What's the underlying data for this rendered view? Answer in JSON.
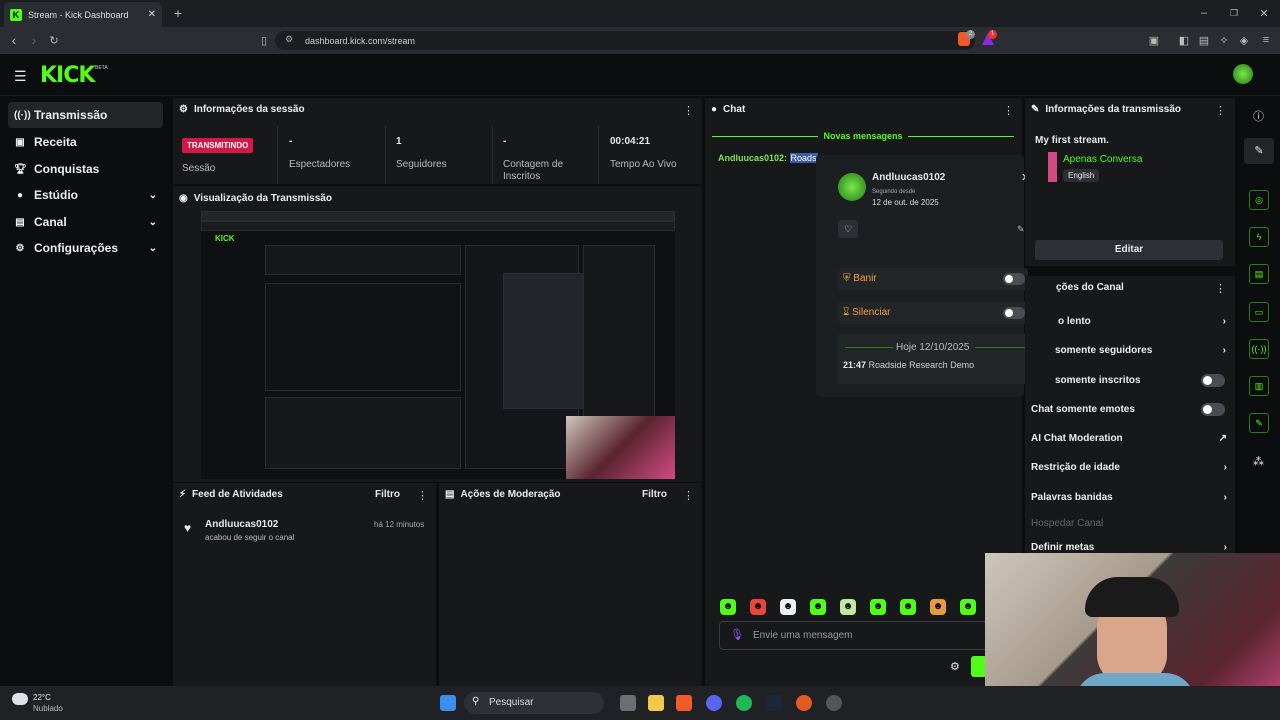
{
  "browser": {
    "tab_title": "Stream - Kick Dashboard",
    "url": "dashboard.kick.com/stream",
    "ext_badge_1": "2",
    "ext_badge_2": "1"
  },
  "app": {
    "logo": "KICK",
    "beta": "BETA"
  },
  "sidebar": {
    "items": [
      {
        "label": "Transmissão",
        "icon": "broadcast-icon"
      },
      {
        "label": "Receita",
        "icon": "revenue-icon"
      },
      {
        "label": "Conquistas",
        "icon": "trophy-icon"
      },
      {
        "label": "Estúdio",
        "icon": "studio-icon"
      },
      {
        "label": "Canal",
        "icon": "channel-icon"
      },
      {
        "label": "Configurações",
        "icon": "gear-icon"
      }
    ]
  },
  "session": {
    "title": "Informações da sessão",
    "live_badge": "TRANSMITINDO",
    "session_label": "Sessão",
    "viewers_value": "-",
    "viewers_label": "Espectadores",
    "followers_value": "1",
    "followers_label": "Seguidores",
    "subs_value": "-",
    "subs_label": "Contagem de Inscritos",
    "live_time_value": "00:04:21",
    "live_time_label": "Tempo Ao Vivo"
  },
  "preview": {
    "title": "Visualização da Transmissão"
  },
  "activity": {
    "title": "Feed de Atividades",
    "filter": "Filtro",
    "item_user": "Andluucas0102",
    "item_time": "há 12 minutos",
    "item_text": "acabou de seguir o canal"
  },
  "moderation": {
    "title": "Ações de Moderação",
    "filter": "Filtro"
  },
  "chat": {
    "title": "Chat",
    "new_messages": "Novas mensagens",
    "message_user": "Andluucas0102:",
    "message_text": "Roads",
    "input_placeholder": "Envie uma mensagem"
  },
  "user_card": {
    "username": "Andluucas0102",
    "following_since_label": "Seguindo desde",
    "following_since_date": "12 de out. de 2025",
    "ban_label": "Banir",
    "mute_label": "Silenciar",
    "date_divider": "Hoje 12/10/2025",
    "log_time": "21:47",
    "log_text": "Roadside Research Demo"
  },
  "stream_info": {
    "title": "Informações da transmissão",
    "stream_title": "My first stream.",
    "category": "Apenas Conversa",
    "language": "English",
    "edit_button": "Editar"
  },
  "channel_actions": {
    "title": "ções do Canal",
    "rows": [
      "o lento",
      "somente seguidores",
      "somente inscritos",
      "Chat somente emotes",
      "AI Chat Moderation",
      "Restrição de idade",
      "Palavras banidas",
      "Hospedar Canal",
      "Definir metas"
    ]
  },
  "taskbar": {
    "temperature": "22°C",
    "weather": "Nublado",
    "search": "Pesquisar"
  },
  "colors": {
    "accent": "#53fc18",
    "live": "#d31848",
    "panel": "#16181a"
  }
}
